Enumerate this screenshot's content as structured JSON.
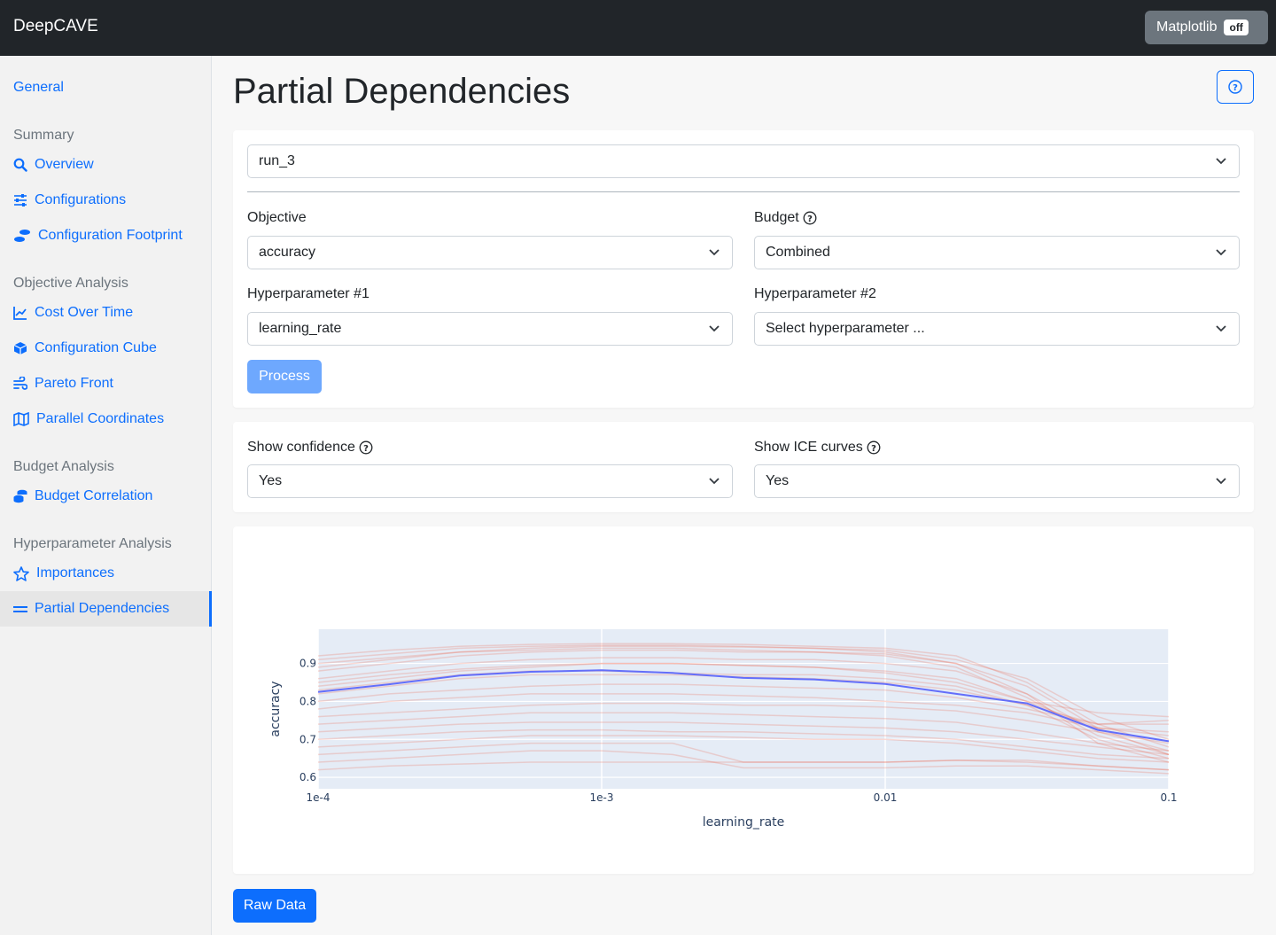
{
  "app": {
    "title": "DeepCAVE"
  },
  "matplotlib_toggle": {
    "label": "Matplotlib",
    "state": "off"
  },
  "sidebar": {
    "general": "General",
    "sections": [
      {
        "heading": "Summary",
        "items": [
          "Overview",
          "Configurations",
          "Configuration Footprint"
        ]
      },
      {
        "heading": "Objective Analysis",
        "items": [
          "Cost Over Time",
          "Configuration Cube",
          "Pareto Front",
          "Parallel Coordinates"
        ]
      },
      {
        "heading": "Budget Analysis",
        "items": [
          "Budget Correlation"
        ]
      },
      {
        "heading": "Hyperparameter Analysis",
        "items": [
          "Importances",
          "Partial Dependencies"
        ]
      }
    ],
    "active_item": "Partial Dependencies"
  },
  "page": {
    "title": "Partial Dependencies"
  },
  "inputs": {
    "run": "run_3",
    "objective_label": "Objective",
    "objective_value": "accuracy",
    "budget_label": "Budget",
    "budget_value": "Combined",
    "hp1_label": "Hyperparameter #1",
    "hp1_value": "learning_rate",
    "hp2_label": "Hyperparameter #2",
    "hp2_placeholder": "Select hyperparameter ...",
    "process_label": "Process"
  },
  "filters": {
    "confidence_label": "Show confidence",
    "confidence_value": "Yes",
    "ice_label": "Show ICE curves",
    "ice_value": "Yes"
  },
  "raw_data_label": "Raw Data",
  "colors": {
    "accent": "#0d6efd",
    "navbar": "#212529",
    "pdp_line": "#636efa",
    "ice_line": "#ef553b",
    "plot_bg": "#e5ecf6"
  },
  "chart_data": {
    "type": "line",
    "xlabel": "learning_rate",
    "ylabel": "accuracy",
    "x_scale": "log",
    "xlim": [
      0.0001,
      0.1
    ],
    "ylim": [
      0.57,
      0.99
    ],
    "x_ticks": [
      "1e-4",
      "1e-3",
      "0.01",
      "0.1"
    ],
    "y_ticks": [
      "0.6",
      "0.7",
      "0.8",
      "0.9"
    ],
    "grid": true,
    "x": [
      0.0001,
      0.000178,
      0.000316,
      0.000562,
      0.001,
      0.00178,
      0.00316,
      0.00562,
      0.01,
      0.0178,
      0.0316,
      0.0562,
      0.1
    ],
    "series": [
      {
        "values": [
          0.825,
          0.845,
          0.868,
          0.878,
          0.882,
          0.875,
          0.862,
          0.858,
          0.846,
          0.82,
          0.795,
          0.725,
          0.695
        ]
      }
    ],
    "ice_curves": [
      [
        0.89,
        0.91,
        0.93,
        0.94,
        0.945,
        0.945,
        0.943,
        0.94,
        0.935,
        0.91,
        0.86,
        0.76,
        0.7
      ],
      [
        0.92,
        0.935,
        0.945,
        0.95,
        0.952,
        0.952,
        0.95,
        0.945,
        0.94,
        0.92,
        0.85,
        0.74,
        0.68
      ],
      [
        0.88,
        0.9,
        0.92,
        0.93,
        0.935,
        0.935,
        0.93,
        0.93,
        0.925,
        0.9,
        0.84,
        0.73,
        0.66
      ],
      [
        0.86,
        0.88,
        0.9,
        0.91,
        0.915,
        0.915,
        0.91,
        0.91,
        0.9,
        0.88,
        0.82,
        0.72,
        0.67
      ],
      [
        0.84,
        0.86,
        0.88,
        0.89,
        0.9,
        0.9,
        0.895,
        0.89,
        0.88,
        0.86,
        0.8,
        0.73,
        0.72
      ],
      [
        0.82,
        0.84,
        0.86,
        0.87,
        0.87,
        0.87,
        0.865,
        0.86,
        0.85,
        0.83,
        0.79,
        0.74,
        0.74
      ],
      [
        0.8,
        0.82,
        0.83,
        0.84,
        0.845,
        0.845,
        0.84,
        0.835,
        0.83,
        0.81,
        0.78,
        0.74,
        0.75
      ],
      [
        0.78,
        0.8,
        0.81,
        0.82,
        0.82,
        0.82,
        0.815,
        0.81,
        0.8,
        0.79,
        0.77,
        0.73,
        0.71
      ],
      [
        0.76,
        0.77,
        0.78,
        0.79,
        0.795,
        0.795,
        0.79,
        0.79,
        0.785,
        0.775,
        0.75,
        0.72,
        0.69
      ],
      [
        0.74,
        0.75,
        0.76,
        0.77,
        0.77,
        0.77,
        0.765,
        0.76,
        0.755,
        0.745,
        0.72,
        0.69,
        0.67
      ],
      [
        0.72,
        0.73,
        0.74,
        0.745,
        0.745,
        0.745,
        0.74,
        0.735,
        0.73,
        0.72,
        0.7,
        0.68,
        0.66
      ],
      [
        0.7,
        0.71,
        0.72,
        0.725,
        0.725,
        0.72,
        0.72,
        0.715,
        0.71,
        0.7,
        0.68,
        0.66,
        0.65
      ],
      [
        0.68,
        0.69,
        0.7,
        0.71,
        0.71,
        0.71,
        0.705,
        0.7,
        0.7,
        0.69,
        0.67,
        0.65,
        0.64
      ],
      [
        0.66,
        0.67,
        0.68,
        0.69,
        0.69,
        0.69,
        0.64,
        0.64,
        0.64,
        0.645,
        0.64,
        0.63,
        0.62
      ],
      [
        0.64,
        0.65,
        0.66,
        0.67,
        0.67,
        0.66,
        0.625,
        0.625,
        0.625,
        0.63,
        0.63,
        0.62,
        0.61
      ],
      [
        0.62,
        0.63,
        0.635,
        0.64,
        0.64,
        0.64,
        0.64,
        0.64,
        0.64,
        0.645,
        0.645,
        0.63,
        0.62
      ],
      [
        0.9,
        0.915,
        0.93,
        0.935,
        0.94,
        0.94,
        0.935,
        0.93,
        0.92,
        0.89,
        0.81,
        0.71,
        0.66
      ],
      [
        0.85,
        0.87,
        0.885,
        0.895,
        0.9,
        0.9,
        0.895,
        0.89,
        0.875,
        0.85,
        0.8,
        0.77,
        0.76
      ],
      [
        0.83,
        0.85,
        0.87,
        0.88,
        0.88,
        0.875,
        0.87,
        0.87,
        0.86,
        0.84,
        0.79,
        0.7,
        0.65
      ],
      [
        0.91,
        0.925,
        0.94,
        0.945,
        0.948,
        0.948,
        0.945,
        0.94,
        0.93,
        0.9,
        0.82,
        0.69,
        0.64
      ]
    ]
  }
}
